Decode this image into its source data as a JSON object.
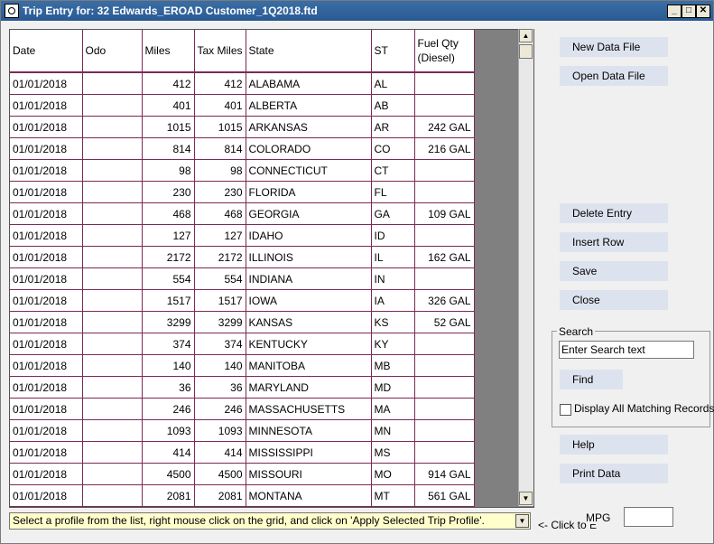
{
  "window": {
    "title": "Trip Entry for: 32 Edwards_EROAD Customer_1Q2018.ftd",
    "minimize": "_",
    "maximize": "□",
    "close": "✕"
  },
  "grid": {
    "columns": [
      "Date",
      "Odo",
      "Miles",
      "Tax Miles",
      "State",
      "ST",
      "Fuel Qty (Diesel)"
    ],
    "rows": [
      {
        "date": "01/01/2018",
        "odo": "",
        "miles": "412",
        "tax_miles": "412",
        "state": "ALABAMA",
        "st": "AL",
        "fuel": ""
      },
      {
        "date": "01/01/2018",
        "odo": "",
        "miles": "401",
        "tax_miles": "401",
        "state": "ALBERTA",
        "st": "AB",
        "fuel": ""
      },
      {
        "date": "01/01/2018",
        "odo": "",
        "miles": "1015",
        "tax_miles": "1015",
        "state": "ARKANSAS",
        "st": "AR",
        "fuel": "242 GAL"
      },
      {
        "date": "01/01/2018",
        "odo": "",
        "miles": "814",
        "tax_miles": "814",
        "state": "COLORADO",
        "st": "CO",
        "fuel": "216 GAL"
      },
      {
        "date": "01/01/2018",
        "odo": "",
        "miles": "98",
        "tax_miles": "98",
        "state": "CONNECTICUT",
        "st": "CT",
        "fuel": ""
      },
      {
        "date": "01/01/2018",
        "odo": "",
        "miles": "230",
        "tax_miles": "230",
        "state": "FLORIDA",
        "st": "FL",
        "fuel": ""
      },
      {
        "date": "01/01/2018",
        "odo": "",
        "miles": "468",
        "tax_miles": "468",
        "state": "GEORGIA",
        "st": "GA",
        "fuel": "109 GAL"
      },
      {
        "date": "01/01/2018",
        "odo": "",
        "miles": "127",
        "tax_miles": "127",
        "state": "IDAHO",
        "st": "ID",
        "fuel": ""
      },
      {
        "date": "01/01/2018",
        "odo": "",
        "miles": "2172",
        "tax_miles": "2172",
        "state": "ILLINOIS",
        "st": "IL",
        "fuel": "162 GAL"
      },
      {
        "date": "01/01/2018",
        "odo": "",
        "miles": "554",
        "tax_miles": "554",
        "state": "INDIANA",
        "st": "IN",
        "fuel": ""
      },
      {
        "date": "01/01/2018",
        "odo": "",
        "miles": "1517",
        "tax_miles": "1517",
        "state": "IOWA",
        "st": "IA",
        "fuel": "326 GAL"
      },
      {
        "date": "01/01/2018",
        "odo": "",
        "miles": "3299",
        "tax_miles": "3299",
        "state": "KANSAS",
        "st": "KS",
        "fuel": "52 GAL"
      },
      {
        "date": "01/01/2018",
        "odo": "",
        "miles": "374",
        "tax_miles": "374",
        "state": "KENTUCKY",
        "st": "KY",
        "fuel": ""
      },
      {
        "date": "01/01/2018",
        "odo": "",
        "miles": "140",
        "tax_miles": "140",
        "state": "MANITOBA",
        "st": "MB",
        "fuel": ""
      },
      {
        "date": "01/01/2018",
        "odo": "",
        "miles": "36",
        "tax_miles": "36",
        "state": "MARYLAND",
        "st": "MD",
        "fuel": ""
      },
      {
        "date": "01/01/2018",
        "odo": "",
        "miles": "246",
        "tax_miles": "246",
        "state": "MASSACHUSETTS",
        "st": "MA",
        "fuel": ""
      },
      {
        "date": "01/01/2018",
        "odo": "",
        "miles": "1093",
        "tax_miles": "1093",
        "state": "MINNESOTA",
        "st": "MN",
        "fuel": ""
      },
      {
        "date": "01/01/2018",
        "odo": "",
        "miles": "414",
        "tax_miles": "414",
        "state": "MISSISSIPPI",
        "st": "MS",
        "fuel": ""
      },
      {
        "date": "01/01/2018",
        "odo": "",
        "miles": "4500",
        "tax_miles": "4500",
        "state": "MISSOURI",
        "st": "MO",
        "fuel": "914 GAL"
      },
      {
        "date": "01/01/2018",
        "odo": "",
        "miles": "2081",
        "tax_miles": "2081",
        "state": "MONTANA",
        "st": "MT",
        "fuel": "561 GAL"
      }
    ]
  },
  "buttons": {
    "new_data_file": "New Data File",
    "open_data_file": "Open Data File",
    "delete_entry": "Delete Entry",
    "insert_row": "Insert Row",
    "save": "Save",
    "close": "Close",
    "find": "Find",
    "help": "Help",
    "print_data": "Print Data"
  },
  "search": {
    "legend": "Search",
    "value": "Enter Search text",
    "display_all_label": "Display All Matching Records"
  },
  "status": {
    "text": "Select a profile from the list, right mouse click on the grid, and click on 'Apply Selected Trip Profile'.",
    "click_hint": "<- Click to E",
    "mpg_label": "MPG",
    "mpg_value": ""
  },
  "colors": {
    "titlebar": "#3a6ea5",
    "grid_lines": "#7b2a55",
    "status_bg": "#ffffcc",
    "button_bg": "#dde3ee"
  }
}
